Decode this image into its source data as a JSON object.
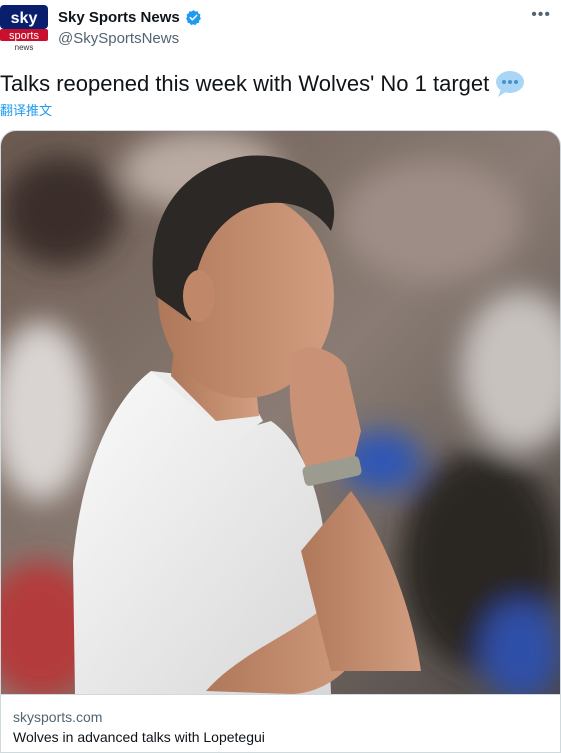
{
  "tweet": {
    "account_name": "Sky Sports News",
    "handle": "@SkySportsNews",
    "avatar_text_top": "sky",
    "avatar_text_mid": "sports",
    "avatar_text_bottom": "news",
    "more_label": "•••",
    "text": "Talks reopened this week with Wolves' No 1 target",
    "translate_label": "翻译推文"
  },
  "card": {
    "domain": "skysports.com",
    "title": "Wolves in advanced talks with Lopetegui"
  },
  "icons": {
    "verified": "verified-badge-icon",
    "speech": "speech-bubble-emoji-icon",
    "more": "more-options-icon"
  },
  "colors": {
    "verified": "#1d9bf0",
    "link": "#1d9bf0",
    "sky_red": "#c8102e"
  }
}
